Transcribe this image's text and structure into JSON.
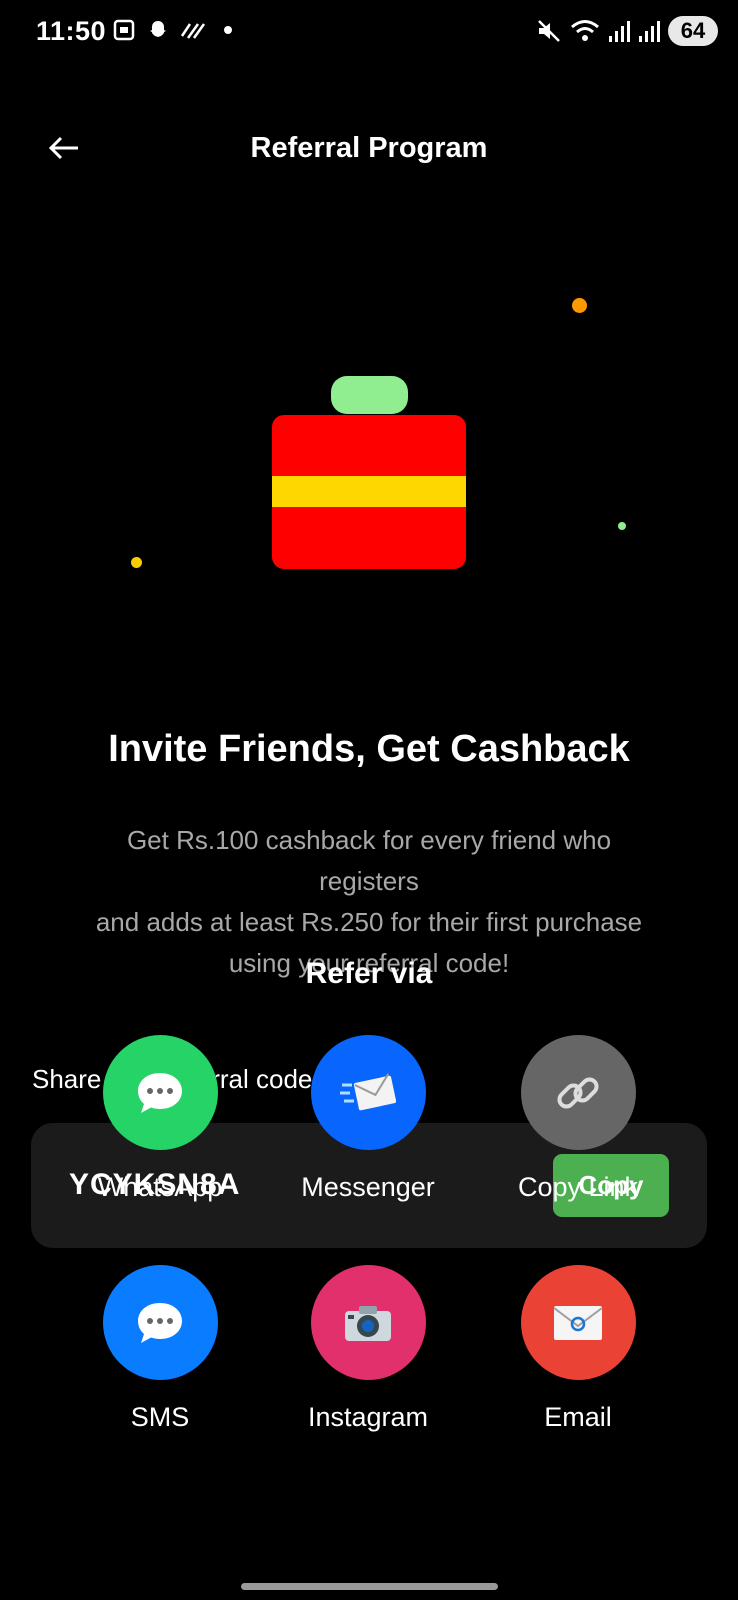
{
  "status_bar": {
    "time": "11:50",
    "battery": "64"
  },
  "header": {
    "title": "Referral Program"
  },
  "hero": {
    "heading": "Invite Friends, Get Cashback",
    "description_lines": [
      "Get Rs.100 cashback for every friend who",
      "registers",
      "and adds at least Rs.250 for their first purchase",
      "using your referral code!"
    ]
  },
  "referral": {
    "share_label": "Share your referral code",
    "code": "YCYKSN8A",
    "copy_label": "Copy"
  },
  "refer_via": {
    "title": "Refer via",
    "options": [
      {
        "label": "WhatsApp",
        "icon": "speech-bubble-icon",
        "color": "#25d366"
      },
      {
        "label": "Messenger",
        "icon": "incoming-envelope-icon",
        "color": "#0866ff"
      },
      {
        "label": "Copy Link",
        "icon": "link-icon",
        "color": "#666666"
      },
      {
        "label": "SMS",
        "icon": "speech-bubble-icon",
        "color": "#0a7cff"
      },
      {
        "label": "Instagram",
        "icon": "camera-icon",
        "color": "#e1306c"
      },
      {
        "label": "Email",
        "icon": "envelope-icon",
        "color": "#ea4335"
      }
    ]
  },
  "colors": {
    "background": "#000000",
    "card": "#1b1b1b",
    "accent_green": "#4caf50",
    "gift_red": "#ff0000",
    "gift_ribbon": "#ffd700",
    "gift_handle": "#90ee90"
  }
}
